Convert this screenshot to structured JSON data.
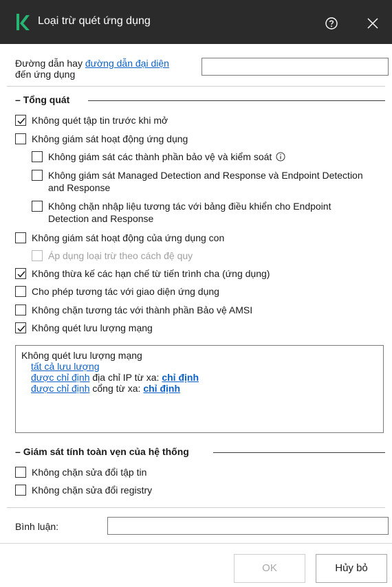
{
  "window": {
    "title": "Loại trừ quét ứng dụng",
    "brand_color": "#27b574"
  },
  "path": {
    "label_prefix": "Đường dẫn hay ",
    "label_link": "đường dẫn đại diện",
    "label_line2": "đến ứng dụng",
    "value": ""
  },
  "general": {
    "header": "Tổng quát",
    "items": [
      {
        "label": "Không quét tập tin trước khi mở",
        "checked": true
      },
      {
        "label": "Không giám sát hoạt động ứng dụng",
        "checked": false
      },
      {
        "label": "Không giám sát các thành phần bảo vệ và kiểm soát",
        "checked": false
      },
      {
        "label": "Không giám sát Managed Detection and Response và Endpoint Detection and Response",
        "checked": false
      },
      {
        "label": "Không chặn nhập liệu tương tác với bảng điều khiển cho Endpoint Detection and Response",
        "checked": false
      },
      {
        "label": "Không giám sát hoạt động của ứng dụng con",
        "checked": false
      },
      {
        "label": "Áp dụng loại trừ theo cách đệ quy",
        "checked": false,
        "disabled": true
      },
      {
        "label": "Không thừa kế các hạn chế từ tiến trình cha (ứng dụng)",
        "checked": true
      },
      {
        "label": "Cho phép tương tác với giao diện ứng dụng",
        "checked": false
      },
      {
        "label": "Không chặn tương tác với thành phần Bảo vệ AMSI",
        "checked": false
      },
      {
        "label": "Không quét lưu lượng mạng",
        "checked": true
      }
    ]
  },
  "network_box": {
    "title": "Không quét lưu lượng mạng",
    "line1_link": "tất cả lưu lượng",
    "line2_link": "được chỉ định",
    "line2_text": " địa chỉ IP từ xa: ",
    "line2_value": "chỉ định",
    "line3_link": "được chỉ định",
    "line3_text": " cổng từ xa: ",
    "line3_value": "chỉ định"
  },
  "integrity": {
    "header": "Giám sát tính toàn vẹn của hệ thống",
    "items": [
      {
        "label": "Không chặn sửa đổi tập tin",
        "checked": false
      },
      {
        "label": "Không chặn sửa đổi registry",
        "checked": false
      }
    ]
  },
  "comment": {
    "label": "Bình luận:",
    "value": ""
  },
  "buttons": {
    "ok": "OK",
    "cancel": "Hủy bỏ"
  }
}
